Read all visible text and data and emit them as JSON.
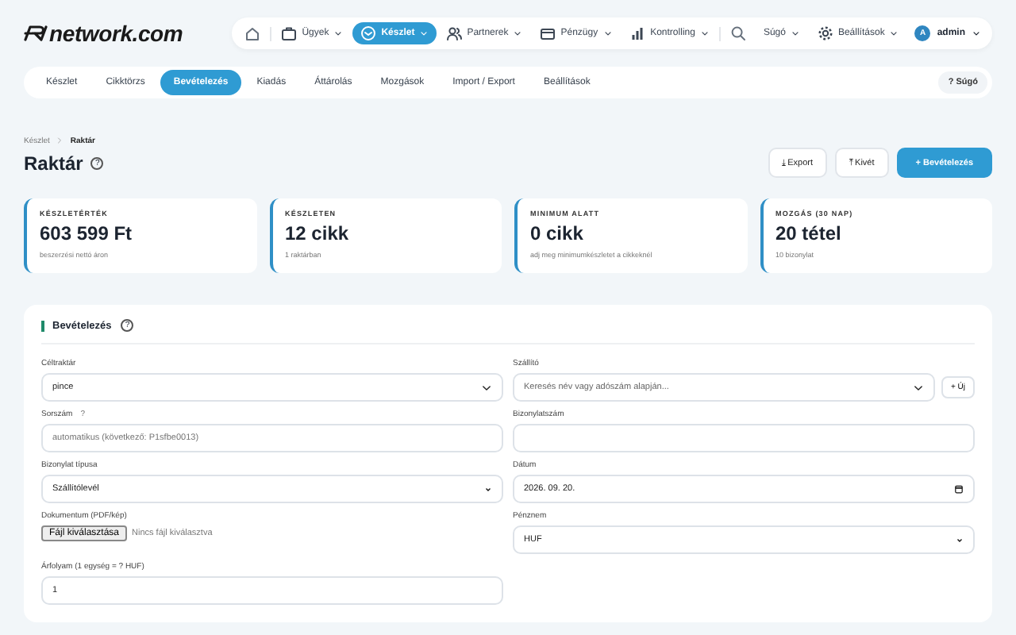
{
  "logo": {
    "text": "network.com"
  },
  "nav": {
    "items": [
      {
        "label": "Ügyek",
        "selected": false
      },
      {
        "label": "Készlet",
        "selected": true
      },
      {
        "label": "Partnerek",
        "selected": false
      },
      {
        "label": "Pénzügy",
        "selected": false
      },
      {
        "label": "Kontrolling",
        "selected": false
      }
    ],
    "help": "Súgó",
    "settings": "Beállítások",
    "user": {
      "initial": "A",
      "name": "admin"
    }
  },
  "subtabs": [
    {
      "label": "Készlet",
      "selected": false
    },
    {
      "label": "Cikktörzs",
      "selected": false
    },
    {
      "label": "Bevételezés",
      "selected": true
    },
    {
      "label": "Kiadás",
      "selected": false
    },
    {
      "label": "Áttárolás",
      "selected": false
    },
    {
      "label": "Mozgások",
      "selected": false
    },
    {
      "label": "Import / Export",
      "selected": false
    },
    {
      "label": "Beállítások",
      "selected": false
    }
  ],
  "subtabs_help": "? Súgó",
  "breadcrumb": [
    "Készlet",
    "Raktár"
  ],
  "title": "Raktár",
  "title_help": "?",
  "actions": [
    {
      "label": "⤓ Export",
      "primary": false
    },
    {
      "label": "⤒ Kivét",
      "primary": false
    },
    {
      "label": "+ Bevételezés",
      "primary": true
    }
  ],
  "stats": [
    {
      "label": "KÉSZLETÉRTÉK",
      "value": "603 599 Ft",
      "note": "beszerzési nettó áron"
    },
    {
      "label": "KÉSZLETEN",
      "value": "12 cikk",
      "note": "1 raktárban"
    },
    {
      "label": "MINIMUM ALATT",
      "value": "0 cikk",
      "note": "adj meg minimumkészletet a cikkeknél"
    },
    {
      "label": "MOZGÁS (30 NAP)",
      "value": "20 tétel",
      "note": "10 bizonylat"
    }
  ],
  "form": {
    "title": "Bevételezés",
    "help": "?",
    "fields": [
      {
        "kind": "combo",
        "label": "Céltraktár",
        "value": "pince"
      },
      {
        "kind": "combo",
        "label": "Szállító",
        "placeholder": "Keresés név vagy adószám alapján...",
        "add": "+ Új"
      },
      {
        "kind": "input",
        "label": "Sorszám",
        "help": "?",
        "placeholder": "automatikus (következő: P1sfbe0013)"
      },
      {
        "kind": "input",
        "label": "Bizonylatszám"
      },
      {
        "kind": "select",
        "label": "Bizonylat típusa",
        "value": "Szállítólevél"
      },
      {
        "kind": "date",
        "label": "Dátum",
        "value": "2026. 09. 20."
      },
      {
        "kind": "file",
        "label": "Dokumentum (PDF/kép)",
        "button": "Fájl kiválasztása",
        "note": "Nincs fájl kiválasztva"
      },
      {
        "kind": "select",
        "label": "Pénznem",
        "value": "HUF"
      },
      {
        "kind": "input",
        "label": "Árfolyam (1 egység = ? HUF)",
        "value": "1"
      }
    ]
  }
}
